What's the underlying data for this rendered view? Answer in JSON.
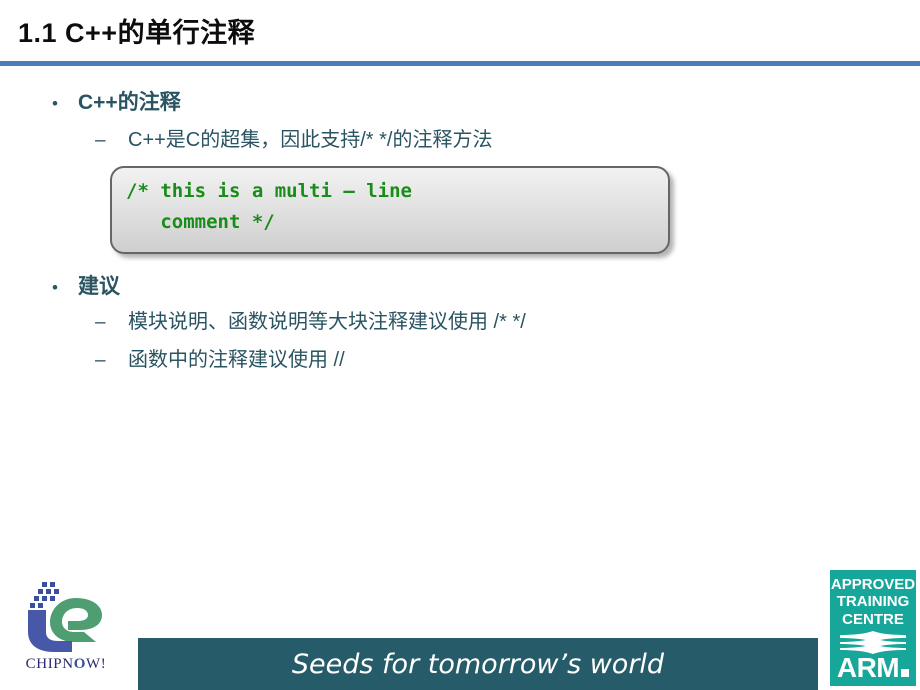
{
  "slide": {
    "title": "1.1 C++的单行注释",
    "accent_rule_color": "#4a7ebb",
    "body_text_color": "#2a5462",
    "code_text_color": "#1a8c1a",
    "banner_color": "#265c69",
    "arm_badge_color": "#17a79a"
  },
  "content": {
    "bullets": [
      {
        "marker": "•",
        "label": "C++的注释",
        "sub": [
          {
            "marker": "–",
            "label": "C++是C的超集，因此支持/* */的注释方法"
          }
        ]
      },
      {
        "marker": "•",
        "label": "建议",
        "sub": [
          {
            "marker": "–",
            "label": "模块说明、函数说明等大块注释建议使用 /* */"
          },
          {
            "marker": "–",
            "label": "函数中的注释建议使用 //"
          }
        ]
      }
    ],
    "code_block": {
      "line1": "/* this is a multi – line",
      "line2": "   comment */",
      "text": "/* this is a multi – line\n   comment */"
    }
  },
  "footer": {
    "tagline": "Seeds for tomorrow’s world",
    "chipnow_logo": {
      "wordmark_before": "CHIPN",
      "wordmark_o": "O",
      "wordmark_after": "W!"
    },
    "arm_badge": {
      "line1": "APPROVED",
      "line2": "TRAINING",
      "line3": "CENTRE",
      "brand": "ARM"
    }
  }
}
